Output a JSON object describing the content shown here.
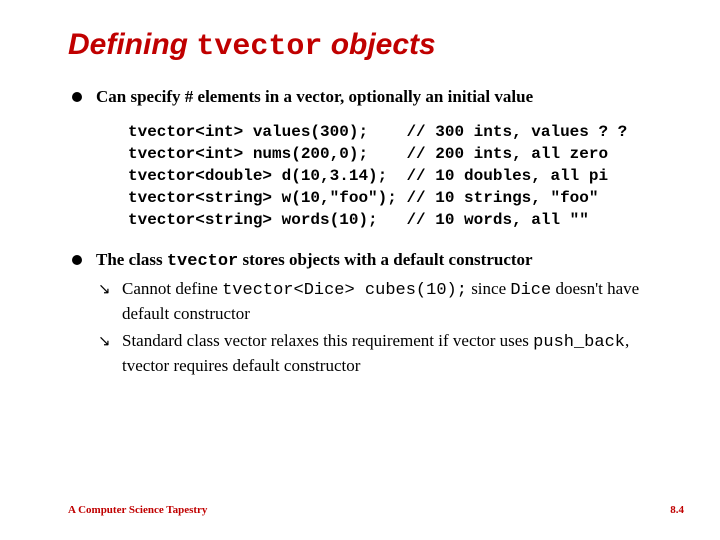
{
  "title": {
    "pre": "Defining ",
    "code": "tvector",
    "post": " objects"
  },
  "bullets": {
    "b1": {
      "text": "Can specify # elements in a vector, optionally an initial value"
    },
    "code_block": "tvector<int> values(300);    // 300 ints, values ? ?\ntvector<int> nums(200,0);    // 200 ints, all zero\ntvector<double> d(10,3.14);  // 10 doubles, all pi\ntvector<string> w(10,\"foo\"); // 10 strings, \"foo\"\ntvector<string> words(10);   // 10 words, all \"\"",
    "b2": {
      "pre": "The class ",
      "code1": "tvector",
      "post": " stores objects with a default constructor"
    },
    "b2_sub1": {
      "pre": "Cannot define ",
      "code1": "tvector<Dice> cubes(10);",
      "mid": " since ",
      "code2": "Dice",
      "post": " doesn't have default constructor"
    },
    "b2_sub2": {
      "pre": "Standard class vector relaxes this requirement if vector uses ",
      "code1": "push_back",
      "post": ", tvector requires default constructor"
    }
  },
  "footer": {
    "left": "A Computer Science Tapestry",
    "right": "8.4"
  }
}
